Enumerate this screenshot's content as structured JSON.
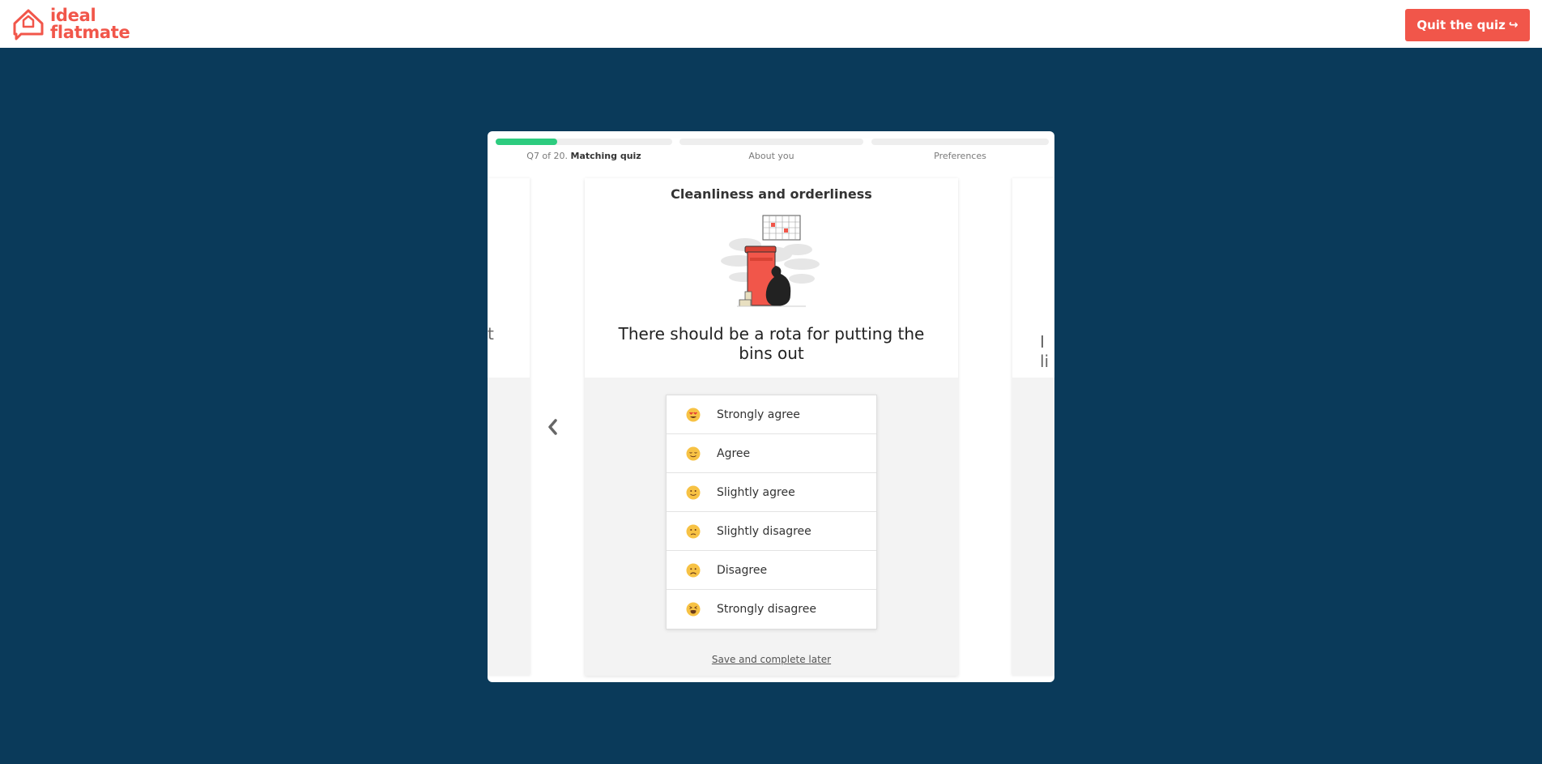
{
  "header": {
    "logo_line1": "ideal",
    "logo_line2": "flatmate",
    "quit_label": "Quit the quiz",
    "brand_color": "#f1564a"
  },
  "progress": {
    "segments": [
      {
        "prefix": "Q7 of 20.",
        "label": "Matching quiz",
        "fill": 0.35
      },
      {
        "label": "About you",
        "fill": 0
      },
      {
        "label": "Preferences",
        "fill": 0
      }
    ],
    "accent": "#2dcc7f"
  },
  "card": {
    "category": "Cleanliness and orderliness",
    "question": "There should be a rota for putting the bins out",
    "options": [
      {
        "label": "Strongly agree",
        "icon": "heart-eyes-emoji-icon"
      },
      {
        "label": "Agree",
        "icon": "relieved-emoji-icon"
      },
      {
        "label": "Slightly agree",
        "icon": "slight-smile-emoji-icon"
      },
      {
        "label": "Slightly disagree",
        "icon": "slight-frown-emoji-icon"
      },
      {
        "label": "Disagree",
        "icon": "frown-emoji-icon"
      },
      {
        "label": "Strongly disagree",
        "icon": "tired-emoji-icon"
      }
    ],
    "save_label": "Save and complete later"
  },
  "peek": {
    "left_text": "t",
    "right_text": "I li"
  }
}
